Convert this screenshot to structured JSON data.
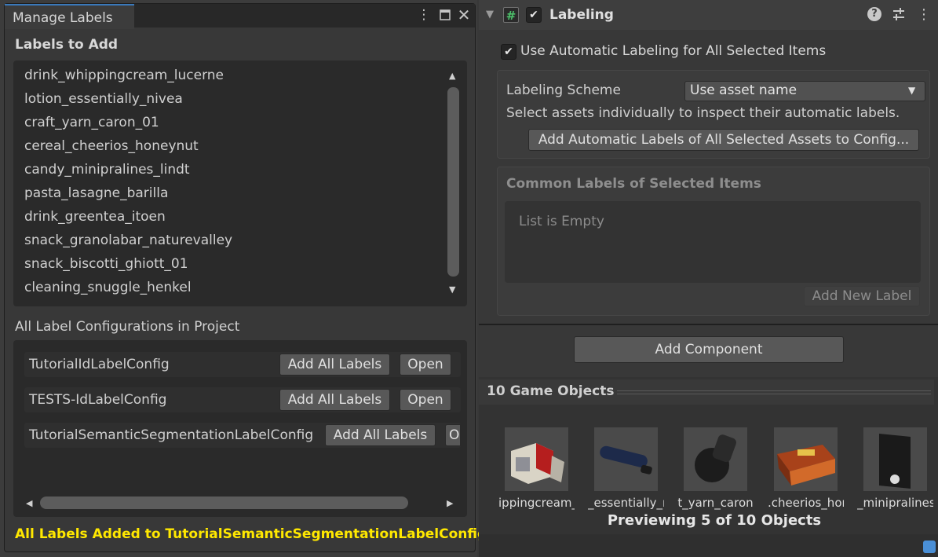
{
  "manage_labels": {
    "tab_title": "Manage Labels",
    "labels_to_add_heading": "Labels to Add",
    "labels": [
      "drink_whippingcream_lucerne",
      "lotion_essentially_nivea",
      "craft_yarn_caron_01",
      "cereal_cheerios_honeynut",
      "candy_minipralines_lindt",
      "pasta_lasagne_barilla",
      "drink_greentea_itoen",
      "snack_granolabar_naturevalley",
      "snack_biscotti_ghiott_01",
      "cleaning_snuggle_henkel"
    ],
    "configs_heading": "All Label Configurations in Project",
    "configs": [
      {
        "name": "TutorialIdLabelConfig",
        "add_all": "Add All Labels",
        "open": "Open"
      },
      {
        "name": "TESTS-IdLabelConfig",
        "add_all": "Add All Labels",
        "open": "Open"
      },
      {
        "name": "TutorialSemanticSegmentationLabelConfig",
        "add_all": "Add All Labels",
        "open": "O"
      }
    ],
    "status": "All Labels Added to TutorialSemanticSegmentationLabelConfig"
  },
  "inspector": {
    "component_title": "Labeling",
    "auto_label_option": "Use Automatic Labeling for All Selected Items",
    "scheme_label": "Labeling Scheme",
    "scheme_value": "Use asset name",
    "scheme_hint": "Select assets individually to inspect their automatic labels.",
    "add_auto_button": "Add Automatic Labels of All Selected Assets to Config...",
    "common_labels_heading": "Common Labels of Selected Items",
    "empty_list_text": "List is Empty",
    "add_new_label": "Add New Label",
    "add_component": "Add Component"
  },
  "preview": {
    "title": "10 Game Objects",
    "captions": [
      "ippingcream_",
      "_essentially_r",
      "t_yarn_caron",
      ".cheerios_hor",
      "_minipralines"
    ],
    "count_text": "Previewing 5 of 10 Objects"
  },
  "colors": {
    "status_yellow": "#ffe800",
    "tab_accent": "#3a79bb",
    "script_icon_green": "#4cc26a"
  }
}
